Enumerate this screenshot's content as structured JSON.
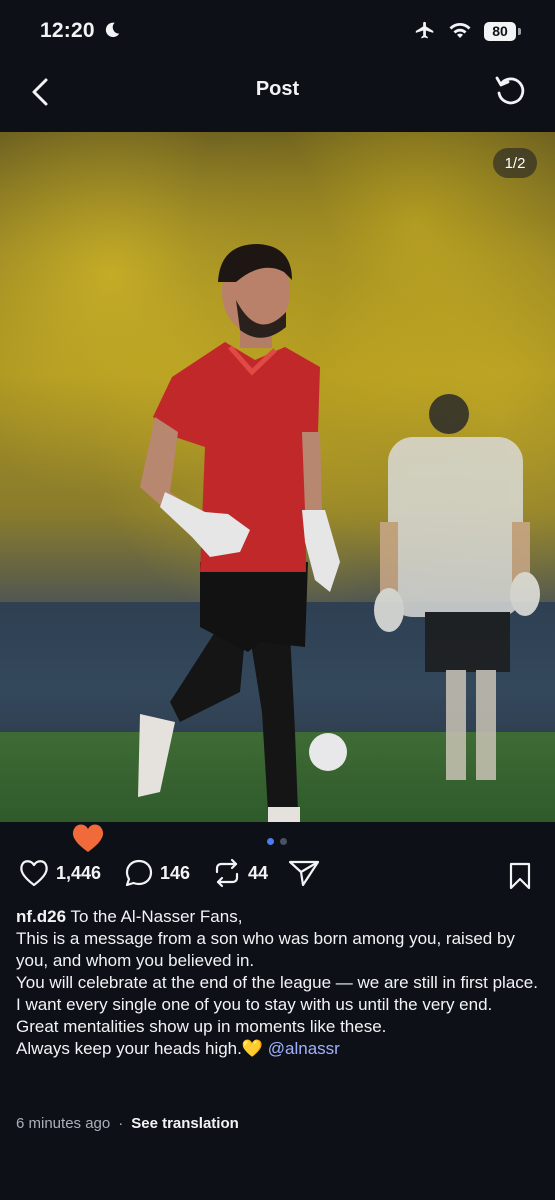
{
  "status_bar": {
    "time": "12:20",
    "battery": "80"
  },
  "header": {
    "title": "Post"
  },
  "post": {
    "image_counter": "1/2",
    "likes": "1,446",
    "comments": "146",
    "reposts": "44",
    "username": "nf.d26",
    "caption_first": "To the Al-Nasser Fans,",
    "caption_lines": [
      "This is a message from a son who was born among you, raised by you, and whom you believed in.",
      "You will celebrate at the end of the league — we are still in first place.",
      "I want every single one of you to stay with us until the very end.",
      "Great mentalities show up in moments like these."
    ],
    "caption_last": "Always keep your heads high.",
    "emoji": "💛",
    "mention": "@alnassr",
    "timestamp": "6 minutes ago",
    "separator": "·",
    "see_translation": "See translation"
  },
  "colors": {
    "background": "#0d1117",
    "accent_dot": "#4c7cf0",
    "mention": "#9fb2ff",
    "heart": "#f06a3a"
  }
}
